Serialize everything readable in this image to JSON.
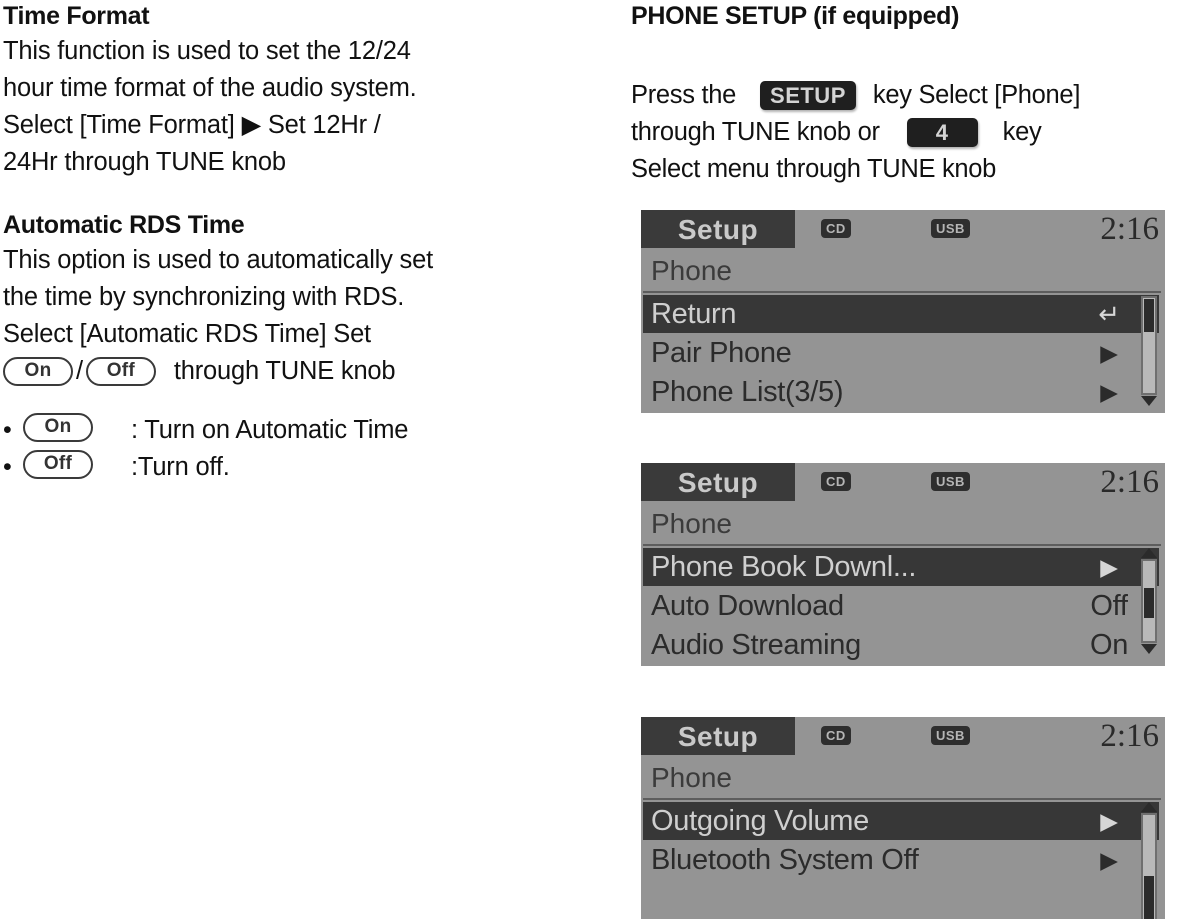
{
  "left_column": {
    "sections": [
      {
        "heading": "Time Format",
        "lines": [
          "This function is used to set the 12/24",
          "hour time format of the audio system.",
          "Select [Time Format] ▶ Set 12Hr /",
          "24Hr through TUNE knob"
        ]
      },
      {
        "heading": "Automatic RDS Time",
        "lines": [
          "This option is used to automatically set",
          "the time by synchronizing with RDS.",
          "Select [Automatic RDS Time] Set"
        ],
        "pill_line": {
          "pill_on": "On",
          "separator": "/",
          "pill_off": "Off",
          "trailing_text": "through TUNE knob"
        }
      }
    ],
    "bullets": [
      {
        "dot": "•",
        "pill": "On",
        "text": ": Turn on Automatic Time"
      },
      {
        "dot": "•",
        "pill": "Off",
        "text": ":Turn off."
      }
    ]
  },
  "right_column": {
    "heading": "PHONE SETUP (if equipped)",
    "instruction": {
      "line1_pre": "Press the",
      "key_setup": "SETUP",
      "line1_post": "key Select [Phone]",
      "line2_pre": "through TUNE knob or",
      "key_number": "4",
      "line2_post": "key",
      "line3": "Select menu through TUNE knob"
    }
  },
  "lcd_panels": [
    {
      "tab": "Setup",
      "badge_cd": "CD",
      "badge_usb": "USB",
      "clock": "2:16",
      "subtitle": "Phone",
      "rows": [
        {
          "label": "Return",
          "value": "↵",
          "value_kind": "return-icon",
          "selected": true
        },
        {
          "label": "Pair Phone",
          "value": "▶",
          "value_kind": "arrow-icon",
          "selected": false
        },
        {
          "label": "Phone List(3/5)",
          "value": "▶",
          "value_kind": "arrow-icon",
          "selected": false
        }
      ],
      "scroll": {
        "arrow_up": false,
        "arrow_down": true,
        "thumb_position": "top"
      }
    },
    {
      "tab": "Setup",
      "badge_cd": "CD",
      "badge_usb": "USB",
      "clock": "2:16",
      "subtitle": "Phone",
      "rows": [
        {
          "label": "Phone Book Downl...",
          "value": "▶",
          "value_kind": "arrow-icon",
          "selected": true
        },
        {
          "label": "Auto Download",
          "value": "Off",
          "value_kind": "text",
          "selected": false
        },
        {
          "label": "Audio Streaming",
          "value": "On",
          "value_kind": "text",
          "selected": false
        }
      ],
      "scroll": {
        "arrow_up": true,
        "arrow_down": true,
        "thumb_position": "middle"
      }
    },
    {
      "tab": "Setup",
      "badge_cd": "CD",
      "badge_usb": "USB",
      "clock": "2:16",
      "subtitle": "Phone",
      "rows": [
        {
          "label": "Outgoing Volume",
          "value": "▶",
          "value_kind": "arrow-icon",
          "selected": true
        },
        {
          "label": "Bluetooth System Off",
          "value": "▶",
          "value_kind": "arrow-icon",
          "selected": false
        },
        {
          "label": "",
          "value": "",
          "value_kind": "empty",
          "selected": false
        }
      ],
      "scroll": {
        "arrow_up": true,
        "arrow_down": false,
        "thumb_position": "bottom"
      }
    }
  ],
  "colors": {
    "lcd_background": "#949494",
    "lcd_highlight": "#373737",
    "lcd_text": "#2b2b2b",
    "lcd_highlight_text": "#cfcfcf",
    "keycap_background": "#1f1f1f",
    "keycap_text": "#d4d4d4",
    "page_background": "#ffffff",
    "body_text": "#111111"
  }
}
